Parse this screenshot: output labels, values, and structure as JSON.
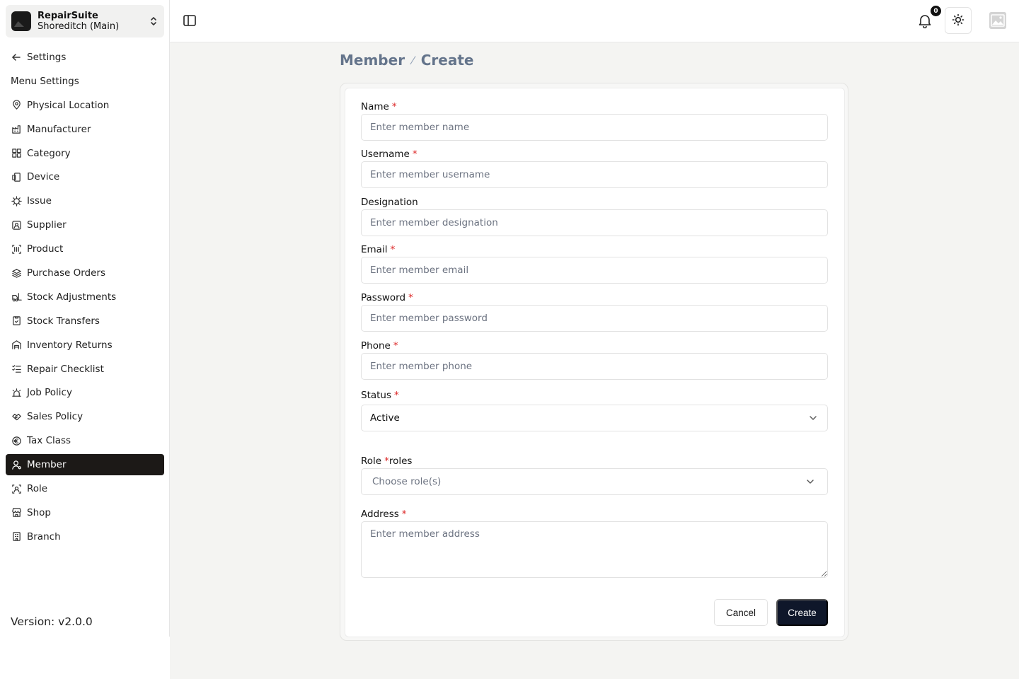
{
  "org": {
    "name": "RepairSuite",
    "branch": "Shoreditch (Main)"
  },
  "sidebar": {
    "back_label": "Settings",
    "section_label": "Menu Settings",
    "items": [
      {
        "label": "Physical Location",
        "icon": "location-icon"
      },
      {
        "label": "Manufacturer",
        "icon": "factory-icon"
      },
      {
        "label": "Category",
        "icon": "category-icon"
      },
      {
        "label": "Device",
        "icon": "device-icon"
      },
      {
        "label": "Issue",
        "icon": "bug-icon"
      },
      {
        "label": "Supplier",
        "icon": "supplier-icon"
      },
      {
        "label": "Product",
        "icon": "barcode-icon"
      },
      {
        "label": "Purchase Orders",
        "icon": "layers-icon"
      },
      {
        "label": "Stock Adjustments",
        "icon": "forklift-icon"
      },
      {
        "label": "Stock Transfers",
        "icon": "transfer-icon"
      },
      {
        "label": "Inventory Returns",
        "icon": "warehouse-icon"
      },
      {
        "label": "Repair Checklist",
        "icon": "checklist-icon"
      },
      {
        "label": "Job Policy",
        "icon": "alarm-icon"
      },
      {
        "label": "Sales Policy",
        "icon": "handshake-icon"
      },
      {
        "label": "Tax Class",
        "icon": "currency-icon"
      },
      {
        "label": "Member",
        "icon": "user-icon",
        "active": true
      },
      {
        "label": "Role",
        "icon": "role-icon"
      },
      {
        "label": "Shop",
        "icon": "store-icon"
      },
      {
        "label": "Branch",
        "icon": "building-icon"
      }
    ],
    "version": "Version: v2.0.0"
  },
  "header": {
    "notification_count": "0"
  },
  "breadcrumb": {
    "parent": "Member",
    "separator": "⁄",
    "current": "Create"
  },
  "form": {
    "name": {
      "label": "Name",
      "required": "*",
      "placeholder": "Enter member name"
    },
    "username": {
      "label": "Username",
      "required": "*",
      "placeholder": "Enter member username"
    },
    "designation": {
      "label": "Designation",
      "placeholder": "Enter member designation"
    },
    "email": {
      "label": "Email",
      "required": "*",
      "placeholder": "Enter member email"
    },
    "password": {
      "label": "Password",
      "required": "*",
      "placeholder": "Enter member password"
    },
    "phone": {
      "label": "Phone",
      "required": "*",
      "placeholder": "Enter member phone"
    },
    "status": {
      "label": "Status",
      "required": "*",
      "value": "Active"
    },
    "role": {
      "label": "Role",
      "required": "*",
      "suffix": "roles",
      "placeholder": "Choose role(s)"
    },
    "address": {
      "label": "Address",
      "required": "*",
      "placeholder": "Enter member address"
    },
    "cancel_label": "Cancel",
    "create_label": "Create"
  },
  "colors": {
    "accent": "#0f172a",
    "active_nav": "#1c1917",
    "required": "#dc2626",
    "breadcrumb": "#64748b"
  }
}
